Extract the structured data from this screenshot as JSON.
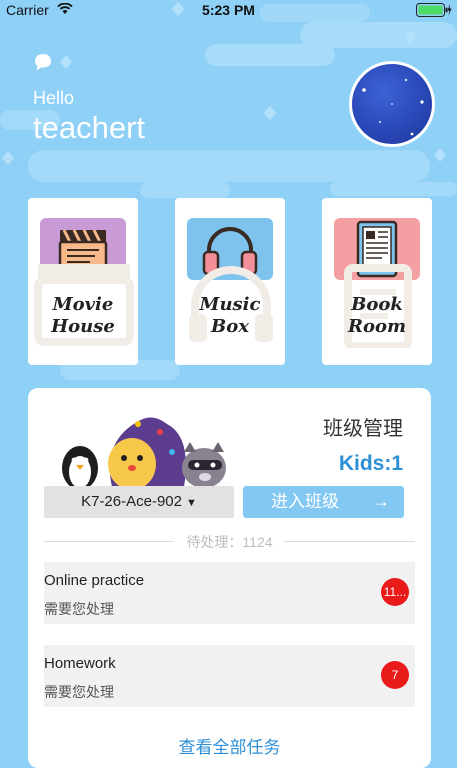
{
  "status_bar": {
    "carrier": "Carrier",
    "time": "5:23 PM"
  },
  "header": {
    "greeting": "Hello",
    "username": "teachert"
  },
  "features": [
    {
      "label": "Movie\nHouse",
      "icon": "clapperboard-icon",
      "tile_color": "#c89bd6"
    },
    {
      "label": "Music\nBox",
      "icon": "headphones-icon",
      "tile_color": "#7ec3ee"
    },
    {
      "label": "Book\nRoom",
      "icon": "ebook-reader-icon",
      "tile_color": "#f4a0a3"
    }
  ],
  "class_panel": {
    "title": "班级管理",
    "kids": "Kids:1",
    "class_selector": "K7-26-Ace-902",
    "enter_button": "进入班级",
    "enter_arrow": "→",
    "pending": "待处理：1124",
    "tasks": [
      {
        "title": "Online practice",
        "subtitle": "需要您处理",
        "badge": "11..."
      },
      {
        "title": "Homework",
        "subtitle": "需要您处理",
        "badge": "7"
      }
    ],
    "view_all": "查看全部任务"
  },
  "colors": {
    "background": "#8fd0f6",
    "accent": "#2d8fd5",
    "badge": "#e81a1a",
    "button": "#82c8f3"
  }
}
